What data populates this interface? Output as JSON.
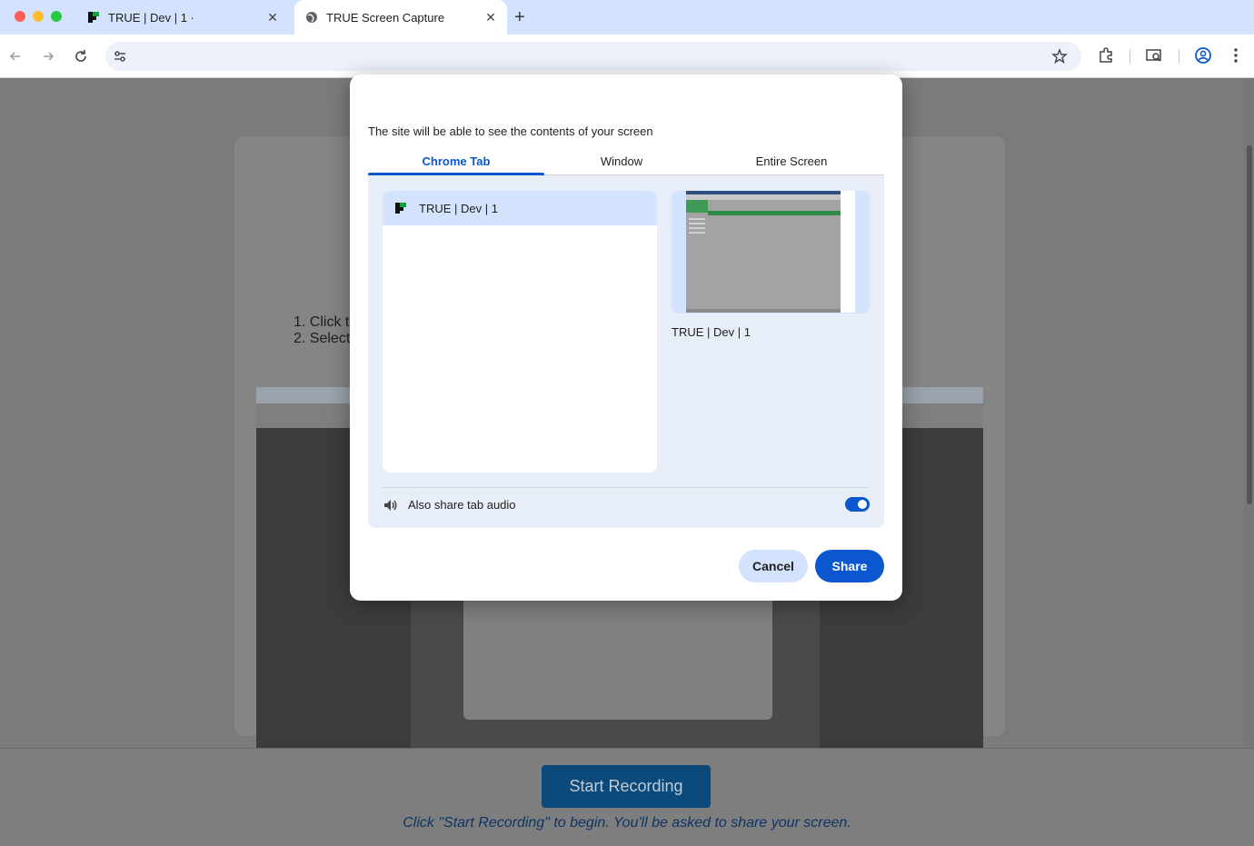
{
  "browser": {
    "tabs": [
      {
        "title": "TRUE | Dev | 1 ·",
        "active": false
      },
      {
        "title": "TRUE Screen Capture",
        "active": true
      }
    ],
    "close_glyph": "✕",
    "new_tab_glyph": "+",
    "icons": {
      "back": "arrow-left-icon",
      "forward": "arrow-right-icon",
      "reload": "reload-icon",
      "site_settings": "tune-icon",
      "bookmark": "star-icon",
      "extensions": "puzzle-icon",
      "cast": "cast-search-icon",
      "profile": "account-circle-icon",
      "menu": "more-vert-icon"
    }
  },
  "page": {
    "steps": [
      "1. Click t",
      "2. Select"
    ],
    "start_button": "Start Recording",
    "hint": "Click \"Start Recording\" to begin. You'll be asked to share your screen."
  },
  "dialog": {
    "subtitle": "The site will be able to see the contents of your screen",
    "tabs": [
      {
        "label": "Chrome Tab",
        "selected": true
      },
      {
        "label": "Window",
        "selected": false
      },
      {
        "label": "Entire Screen",
        "selected": false
      }
    ],
    "list_items": [
      {
        "label": "TRUE | Dev | 1",
        "selected": true
      }
    ],
    "preview_label": "TRUE | Dev | 1",
    "audio_label": "Also share tab audio",
    "audio_enabled": true,
    "cancel_label": "Cancel",
    "share_label": "Share"
  },
  "colors": {
    "accent": "#0b57d0",
    "tabstrip": "#d3e3fd",
    "panel": "#e8eef8"
  }
}
